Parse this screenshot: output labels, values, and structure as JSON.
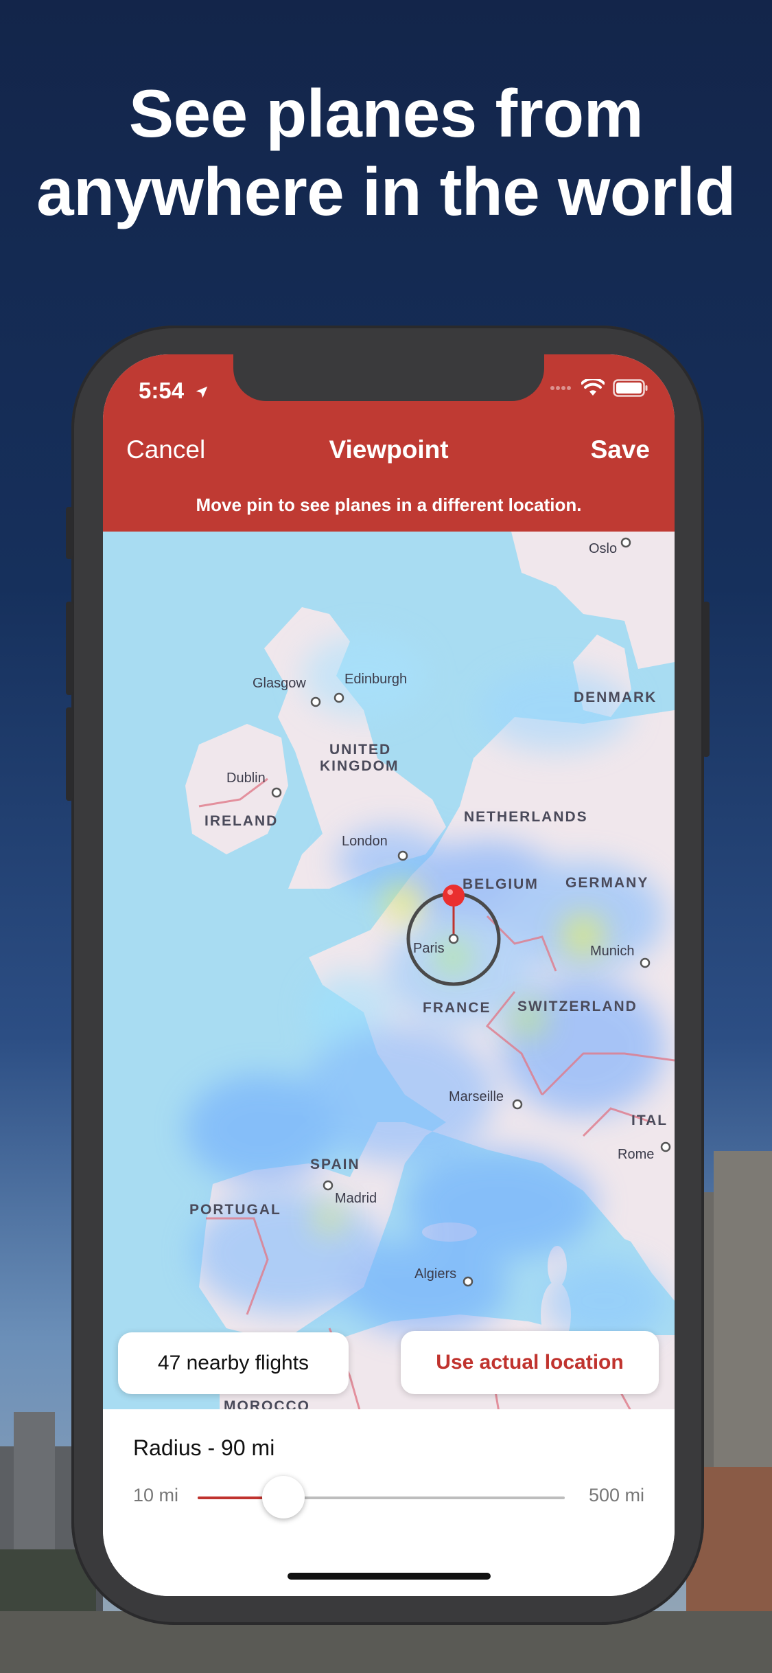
{
  "headline": {
    "line1": "See planes from",
    "line2": "anywhere in the world"
  },
  "status_bar": {
    "time": "5:54",
    "location_icon": "location-arrow-icon",
    "wifi_icon": "wifi-icon",
    "battery_icon": "battery-icon"
  },
  "nav": {
    "cancel_label": "Cancel",
    "title": "Viewpoint",
    "save_label": "Save",
    "hint": "Move pin to see planes in a different location."
  },
  "map": {
    "cities": [
      "Oslo",
      "Glasgow",
      "Edinburgh",
      "Dublin",
      "London",
      "Paris",
      "Munich",
      "Marseille",
      "Rome",
      "Madrid",
      "Algiers"
    ],
    "countries": [
      "DENMARK",
      "UNITED",
      "KINGDOM",
      "IRELAND",
      "NETHERLANDS",
      "BELGIUM",
      "GERMANY",
      "FRANCE",
      "SWITZERLAND",
      "ITAL",
      "SPAIN",
      "PORTUGAL",
      "MOROCCO"
    ],
    "pin_icon": "map-pin-icon"
  },
  "cards": {
    "nearby_flights": "47 nearby flights",
    "use_actual_location": "Use actual location"
  },
  "radius": {
    "label": "Radius - 90 mi",
    "min_label": "10 mi",
    "max_label": "500 mi",
    "min": 10,
    "max": 500,
    "value": 90
  },
  "colors": {
    "accent": "#bf3a33",
    "action_text": "#c0332e",
    "water": "#a8dcf2",
    "land": "#f0e7ec"
  }
}
